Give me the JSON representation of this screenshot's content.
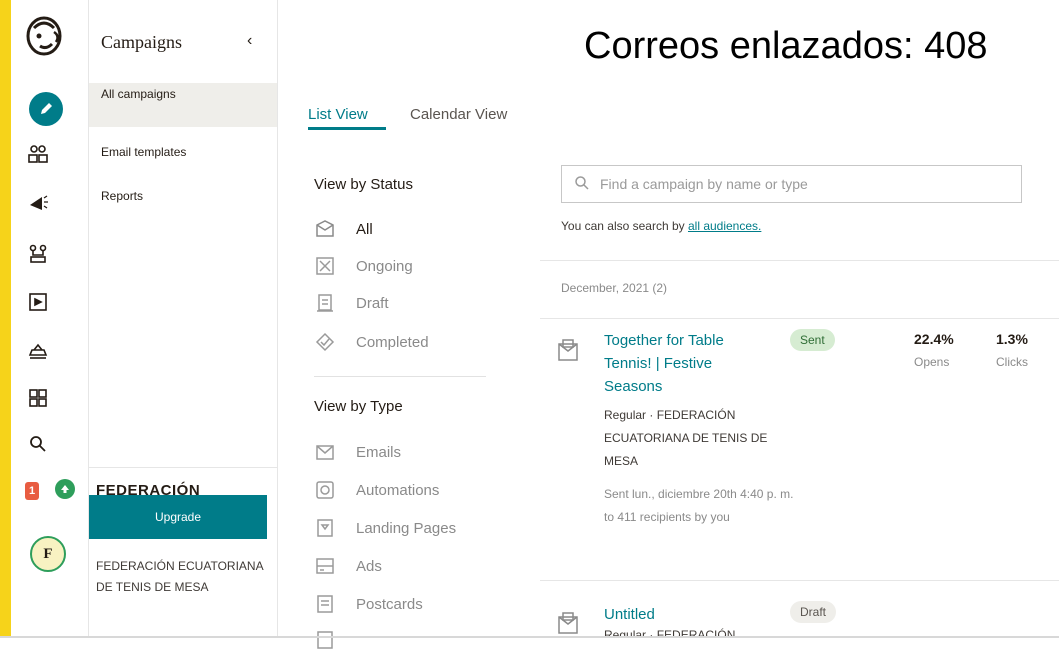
{
  "colors": {
    "accent": "#007c89",
    "brand_bar": "#f6d31a",
    "sent_badge": "#d6ecd2",
    "notification": "#e85c41"
  },
  "rail": {
    "icons": [
      "mailchimp-logo",
      "create-pencil-icon",
      "audience-icon",
      "campaigns-megaphone-icon",
      "automations-icon",
      "website-icon",
      "content-icon",
      "integrations-grid-icon",
      "search-icon"
    ],
    "notification_count": "1",
    "avatar_letter": "F"
  },
  "subnav": {
    "title": "Campaigns",
    "items": [
      {
        "label": "All campaigns",
        "active": true
      },
      {
        "label": "Email templates",
        "active": false
      },
      {
        "label": "Reports",
        "active": false
      }
    ],
    "org_name_large": "FEDERACIÓN ECUATORIANA DE TENIS DE MESA",
    "upgrade_label": "Upgrade",
    "org_name_small": "FEDERACIÓN ECUATORIANA DE TENIS DE MESA"
  },
  "overlay_heading": "Correos enlazados: 408",
  "tabs": [
    {
      "label": "List View",
      "active": true
    },
    {
      "label": "Calendar View",
      "active": false
    }
  ],
  "filters": {
    "status_heading": "View by Status",
    "status": [
      "All",
      "Ongoing",
      "Draft",
      "Completed"
    ],
    "type_heading": "View by Type",
    "type": [
      "Emails",
      "Automations",
      "Landing Pages",
      "Ads",
      "Postcards"
    ]
  },
  "search": {
    "placeholder": "Find a campaign by name or type",
    "also_prefix": "You can also search by ",
    "also_link": "all audiences."
  },
  "group_date": "December, 2021 (2)",
  "campaigns": [
    {
      "title": "Together for Table Tennis! | Festive Seasons",
      "status": "Sent",
      "meta": "Regular · FEDERACIÓN ECUATORIANA DE TENIS DE MESA",
      "sent_info": "Sent lun., diciembre 20th 4:40 p. m. to 411 recipients by you",
      "opens_value": "22.4%",
      "opens_label": "Opens",
      "clicks_value": "1.3%",
      "clicks_label": "Clicks"
    },
    {
      "title": "Untitled",
      "status": "Draft",
      "meta": "Regular · FEDERACIÓN"
    }
  ]
}
